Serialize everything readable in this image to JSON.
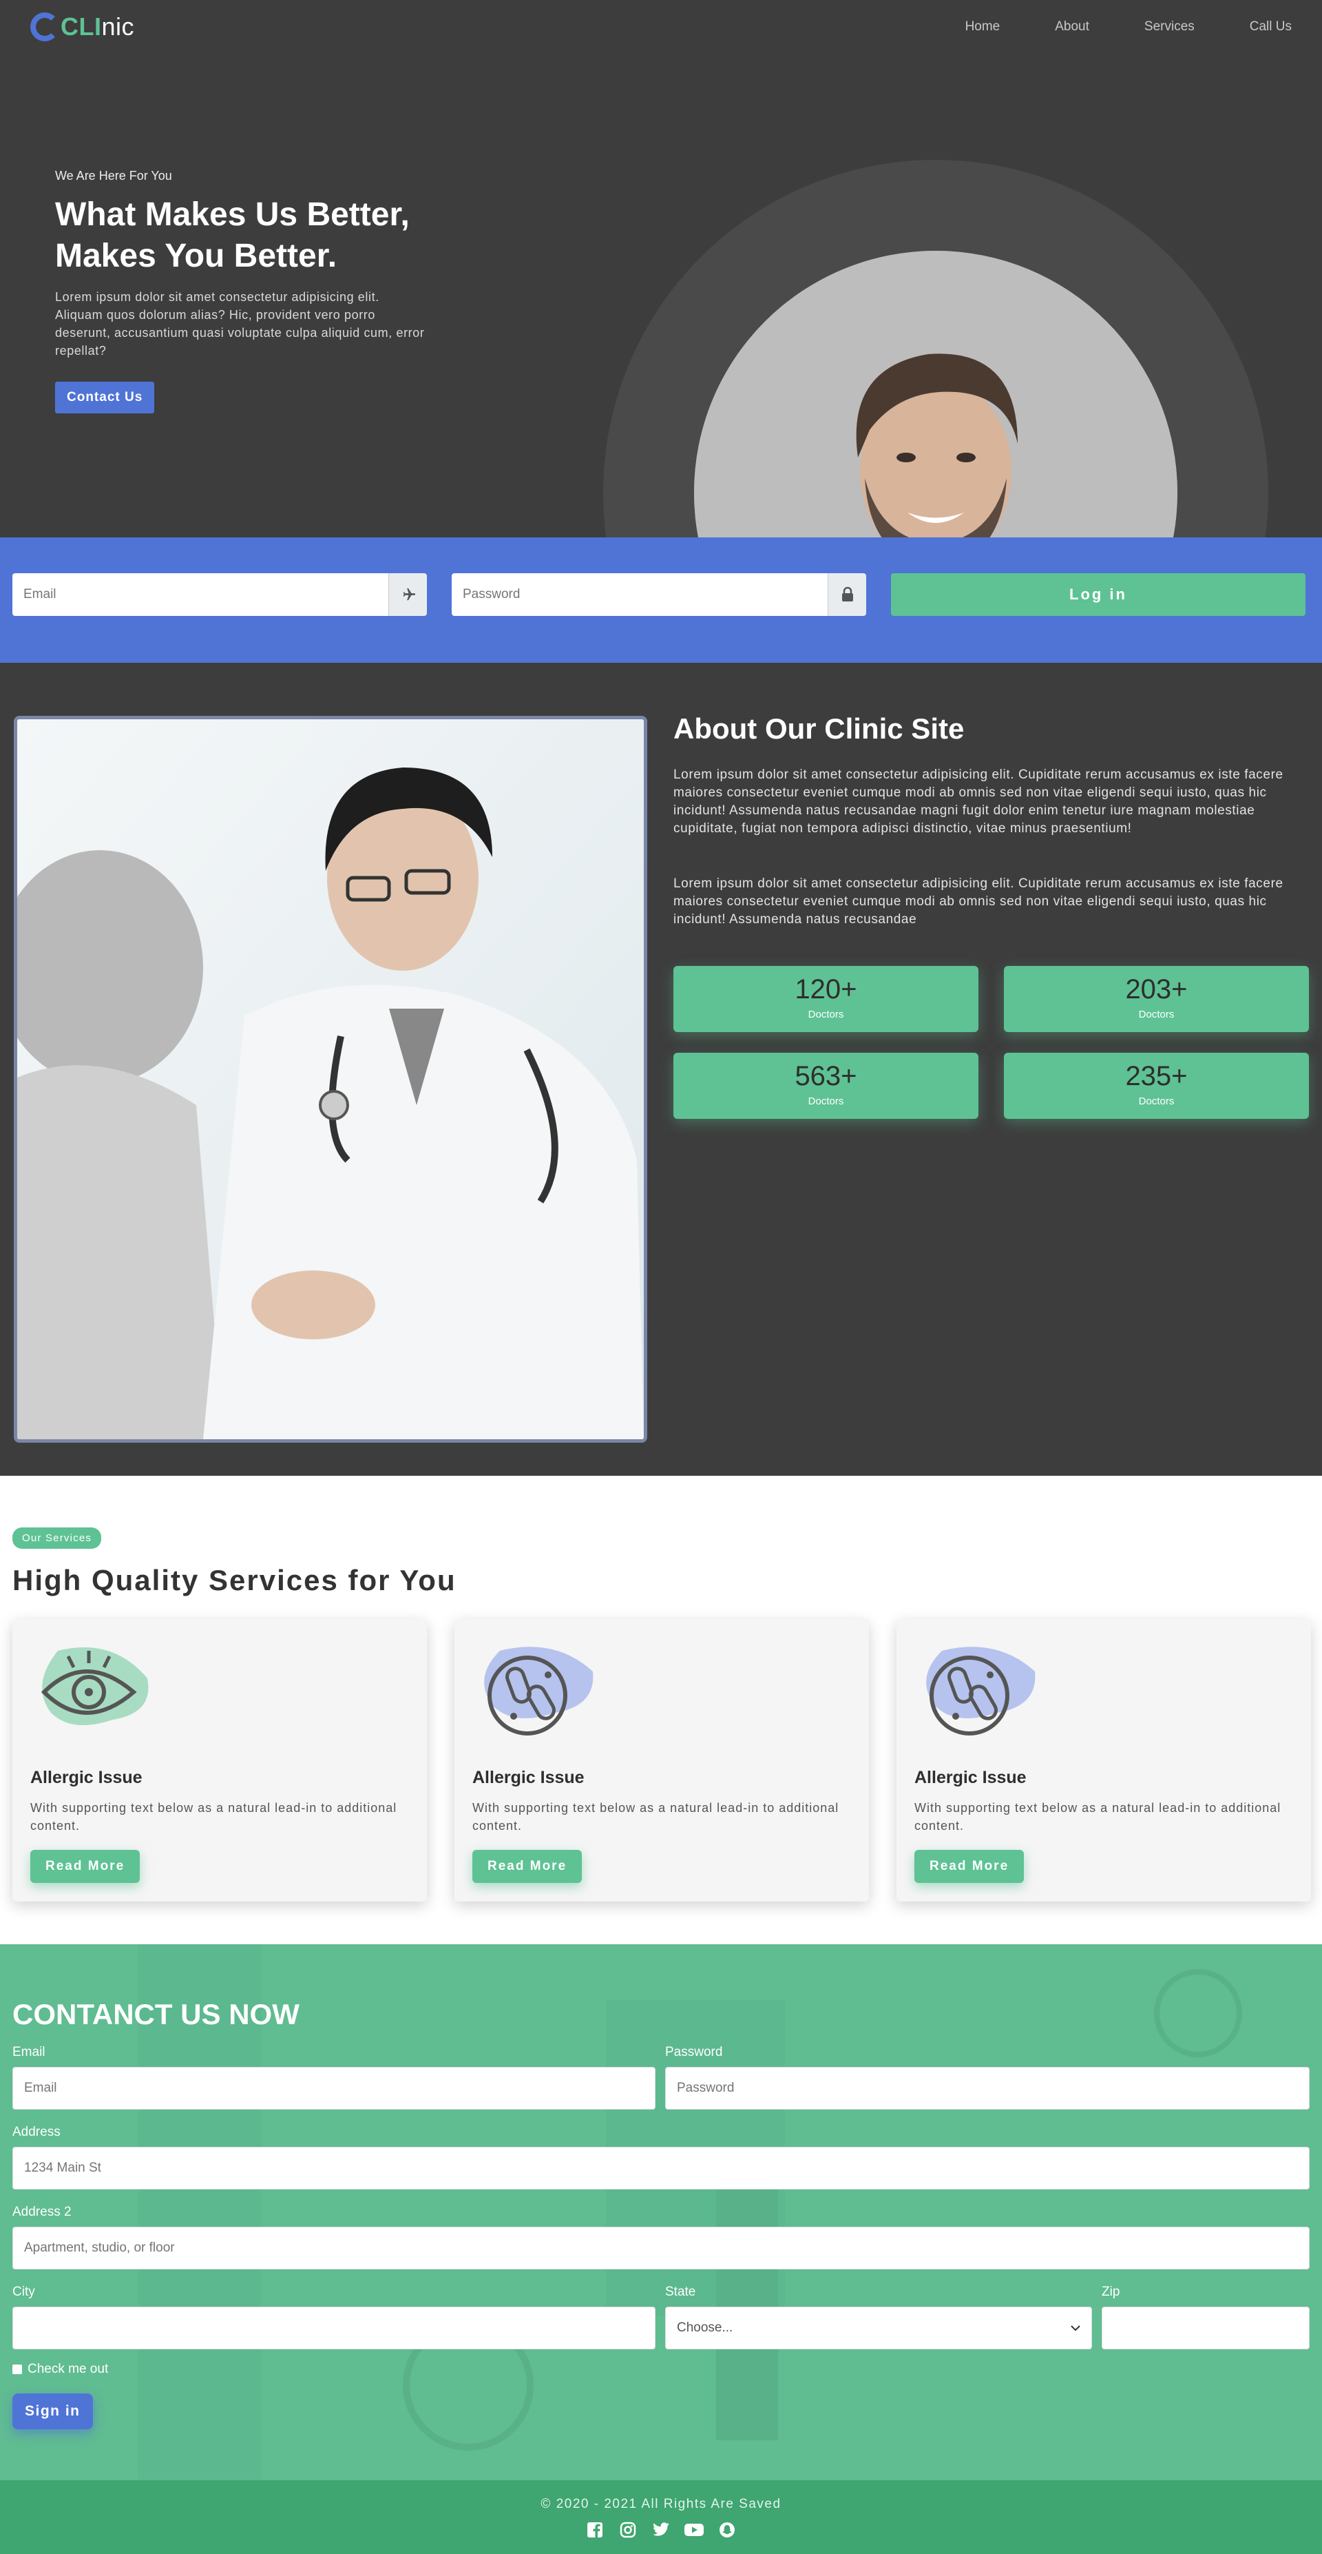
{
  "brand": {
    "logo_cl": "CLI",
    "logo_nic": "nic"
  },
  "nav": {
    "items": [
      {
        "label": "Home"
      },
      {
        "label": "About"
      },
      {
        "label": "Services"
      },
      {
        "label": "Call Us"
      }
    ]
  },
  "hero": {
    "eyebrow": "We Are Here For You",
    "title_line1": "What Makes Us Better,",
    "title_line2": "Makes You Better.",
    "description": "Lorem ipsum dolor sit amet consectetur adipisicing elit. Aliquam quos dolorum alias? Hic, provident vero porro deserunt, accusantium quasi voluptate culpa aliquid cum, error repellat?",
    "cta": "Contact Us"
  },
  "login": {
    "email_placeholder": "Email",
    "password_placeholder": "Password",
    "email_icon": "plane-icon",
    "password_icon": "lock-icon",
    "button": "Log in"
  },
  "about": {
    "title": "About Our Clinic Site",
    "p1": "Lorem ipsum dolor sit amet consectetur adipisicing elit. Cupiditate rerum accusamus ex iste facere maiores consectetur eveniet cumque modi ab omnis sed non vitae eligendi sequi iusto, quas hic incidunt! Assumenda natus recusandae magni fugit dolor enim tenetur iure magnam molestiae cupiditate, fugiat non tempora adipisci distinctio, vitae minus praesentium!",
    "p2": "Lorem ipsum dolor sit amet consectetur adipisicing elit. Cupiditate rerum accusamus ex iste facere maiores consectetur eveniet cumque modi ab omnis sed non vitae eligendi sequi iusto, quas hic incidunt! Assumenda natus recusandae",
    "stats": [
      {
        "value": "120+",
        "label": "Doctors"
      },
      {
        "value": "203+",
        "label": "Doctors"
      },
      {
        "value": "563+",
        "label": "Doctors"
      },
      {
        "value": "235+",
        "label": "Doctors"
      }
    ]
  },
  "services": {
    "badge": "Our Services",
    "title": "High Quality Services for You",
    "cards": [
      {
        "icon": "eye-icon",
        "title": "Allergic Issue",
        "text": "With supporting text below as a natural lead-in to additional content.",
        "button": "Read More"
      },
      {
        "icon": "bacteria-icon",
        "title": "Allergic Issue",
        "text": "With supporting text below as a natural lead-in to additional content.",
        "button": "Read More"
      },
      {
        "icon": "bacteria-icon",
        "title": "Allergic Issue",
        "text": "With supporting text below as a natural lead-in to additional content.",
        "button": "Read More"
      }
    ]
  },
  "contact": {
    "title": "CONTANCT US NOW",
    "email_label": "Email",
    "email_placeholder": "Email",
    "password_label": "Password",
    "password_placeholder": "Password",
    "address_label": "Address",
    "address_placeholder": "1234 Main St",
    "address2_label": "Address 2",
    "address2_placeholder": "Apartment, studio, or floor",
    "city_label": "City",
    "city_value": "",
    "state_label": "State",
    "state_value": "Choose...",
    "zip_label": "Zip",
    "zip_value": "",
    "check_label": "Check me out",
    "submit": "Sign in"
  },
  "footer": {
    "copyright": "© 2020 - 2021 All Rights Are Saved",
    "socials": [
      "facebook-icon",
      "instagram-icon",
      "twitter-icon",
      "youtube-icon",
      "snapchat-icon"
    ]
  },
  "colors": {
    "dark": "#3d3d3d",
    "blue": "#4f74d6",
    "green": "#5ec294",
    "footer_green": "#3fa571"
  }
}
